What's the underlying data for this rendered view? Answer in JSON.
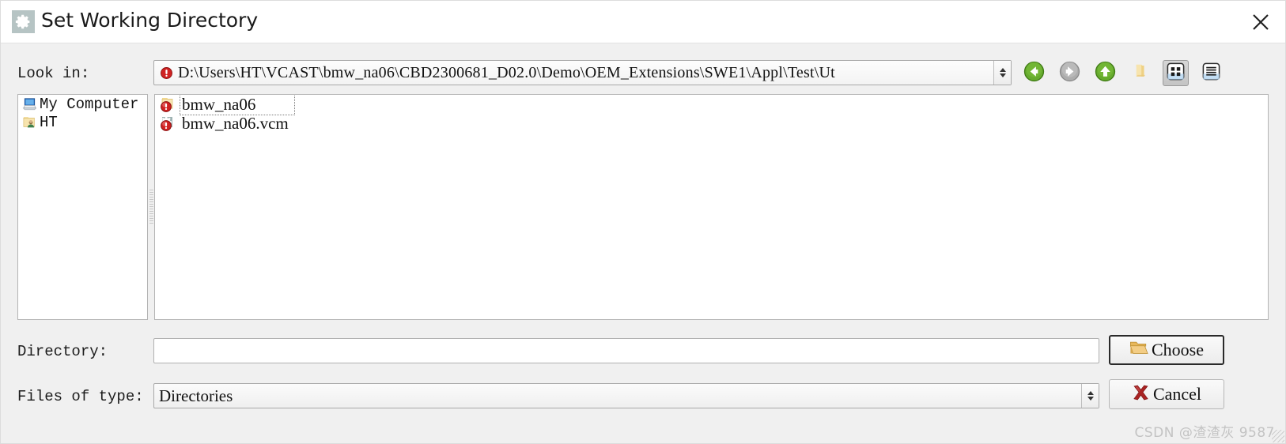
{
  "window": {
    "title": "Set Working Directory",
    "icon": "gear-icon",
    "close_label": "✕"
  },
  "toolbar": {
    "lookin_label": "Look in:",
    "path_value": "D:\\Users\\HT\\VCAST\\bmw_na06\\CBD2300681_D02.0\\Demo\\OEM_Extensions\\SWE1\\Appl\\Test\\Ut",
    "buttons": [
      {
        "name": "back-button",
        "icon": "arrow-left-circle-icon",
        "state": "enabled",
        "color": "#5a9e28"
      },
      {
        "name": "forward-button",
        "icon": "arrow-right-circle-icon",
        "state": "disabled",
        "color": "#a8a8a8"
      },
      {
        "name": "parent-dir-button",
        "icon": "arrow-up-circle-icon",
        "state": "enabled",
        "color": "#5a9e28"
      },
      {
        "name": "new-folder-button",
        "icon": "new-folder-icon",
        "state": "enabled",
        "color": "#f2d38a"
      },
      {
        "name": "list-view-button",
        "icon": "grid-view-icon",
        "state": "selected",
        "color": "#2f6fb5"
      },
      {
        "name": "detail-view-button",
        "icon": "detail-view-icon",
        "state": "enabled",
        "color": "#2f6fb5"
      }
    ]
  },
  "sidebar": {
    "items": [
      {
        "label": "My Computer",
        "icon": "computer-icon"
      },
      {
        "label": "HT",
        "icon": "user-folder-icon"
      }
    ]
  },
  "filelist": {
    "items": [
      {
        "label": "bmw_na06",
        "icon": "folder-error-icon",
        "focused": true
      },
      {
        "label": "bmw_na06.vcm",
        "icon": "gear-error-icon",
        "focused": false
      }
    ]
  },
  "fields": {
    "directory_label": "Directory:",
    "directory_value": "",
    "directory_placeholder": "",
    "filetype_label": "Files of type:",
    "filetype_value": "Directories",
    "filetype_options": [
      "Directories"
    ]
  },
  "buttons": {
    "choose_label": "Choose",
    "choose_icon": "open-folder-icon",
    "cancel_label": "Cancel",
    "cancel_icon": "red-x-icon"
  },
  "watermark": {
    "text": "CSDN @渣渣灰 9587"
  },
  "colors": {
    "dialog_bg": "#f0f0f0",
    "titlebar_bg": "#ffffff",
    "panel_bg": "#ffffff",
    "accent_green": "#5a9e28",
    "accent_red": "#cf2222",
    "folder_yellow": "#f0c868"
  }
}
